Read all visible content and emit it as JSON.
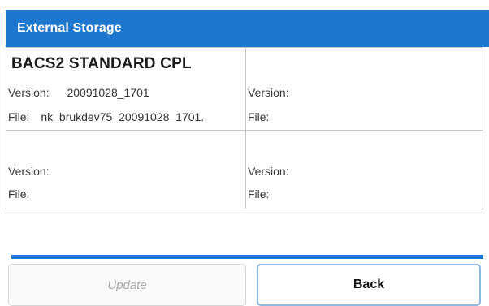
{
  "header": {
    "title": "External Storage"
  },
  "slots": [
    {
      "title": "BACS2 STANDARD CPL",
      "version_label": "Version:",
      "version_value": "20091028_1701",
      "file_label": "File:",
      "file_value": "nk_brukdev75_20091028_1701."
    },
    {
      "title": "",
      "version_label": "Version:",
      "version_value": "",
      "file_label": "File:",
      "file_value": ""
    },
    {
      "title": "",
      "version_label": "Version:",
      "version_value": "",
      "file_label": "File:",
      "file_value": ""
    },
    {
      "title": "",
      "version_label": "Version:",
      "version_value": "",
      "file_label": "File:",
      "file_value": ""
    }
  ],
  "buttons": {
    "update_label": "Update",
    "back_label": "Back"
  },
  "colors": {
    "accent": "#1e77cf",
    "disabled_text": "#a9a9a9"
  }
}
